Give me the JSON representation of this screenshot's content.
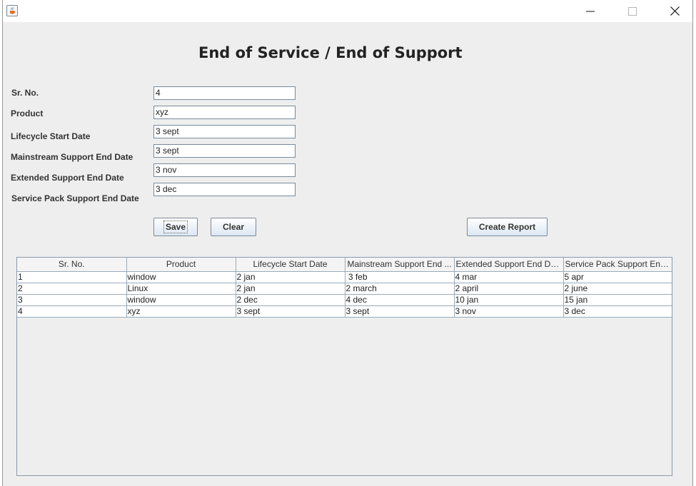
{
  "window": {
    "icon": "java-cup-icon"
  },
  "form": {
    "title": "End of Service / End of Support",
    "fields": [
      {
        "label": "Sr. No.",
        "value": "4"
      },
      {
        "label": "Product",
        "value": "xyz"
      },
      {
        "label": "Lifecycle Start Date",
        "value": "3 sept"
      },
      {
        "label": "Mainstream Support End Date",
        "value": "3 sept"
      },
      {
        "label": "Extended Support End Date",
        "value": "3 nov"
      },
      {
        "label": "Service Pack Support End Date",
        "value": "3 dec"
      }
    ],
    "buttons": {
      "save": "Save",
      "clear": "Clear",
      "create_report": "Create Report"
    }
  },
  "table": {
    "columns": [
      "Sr. No.",
      "Product",
      "Lifecycle Start Date",
      "Mainstream Support End ...",
      "Extended Support End Date",
      "Service Pack Support End..."
    ],
    "rows": [
      [
        "1",
        "window",
        "2 jan",
        " 3 feb",
        "4 mar",
        "5 apr"
      ],
      [
        "2",
        "Linux",
        "2 jan",
        "2 march",
        "2 april",
        "2 june"
      ],
      [
        "3",
        "window",
        "2 dec",
        "4 dec",
        "10 jan",
        "15 jan"
      ],
      [
        "4",
        "xyz",
        "3 sept",
        "3 sept",
        "3 nov",
        "3 dec"
      ]
    ]
  }
}
